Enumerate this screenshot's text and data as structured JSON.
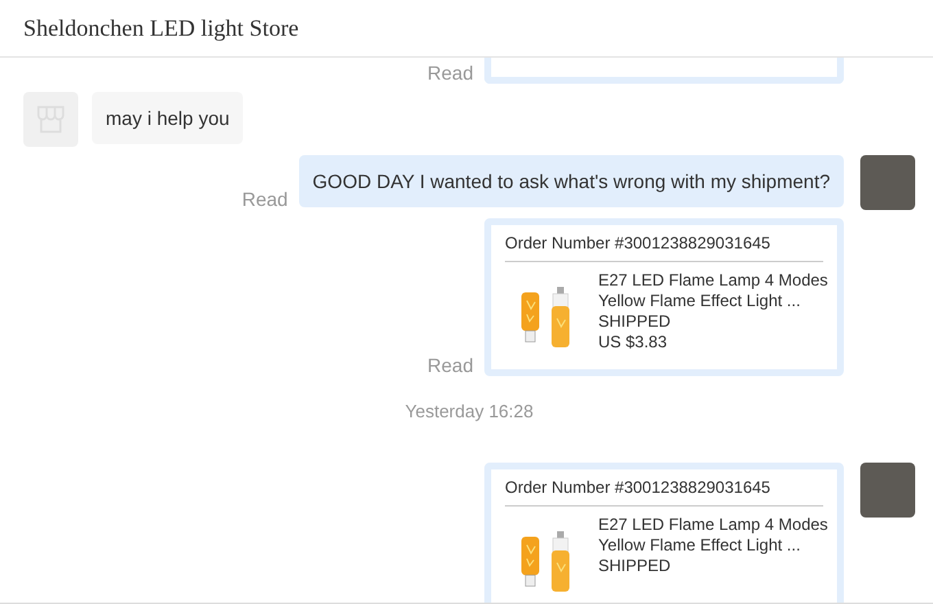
{
  "window": {
    "title": "Sheldonchen LED light Store"
  },
  "messages": [
    {
      "kind": "sent_order_partial",
      "status": "Read",
      "avatar": false
    },
    {
      "kind": "received_text",
      "text": "may i help you",
      "avatar": true
    },
    {
      "kind": "sent_text",
      "text": "GOOD DAY I wanted to ask what's wrong with my shipment?",
      "status": "Read",
      "avatar": true
    },
    {
      "kind": "sent_order",
      "status": "Read",
      "avatar": false,
      "order_number": "Order Number #3001238829031645",
      "product": "E27 LED Flame Lamp 4 Modes Yellow Flame Effect Light ...",
      "state": "SHIPPED",
      "price": "US $3.83"
    },
    {
      "kind": "time",
      "text": "Yesterday 16:28"
    },
    {
      "kind": "sent_order",
      "avatar": true,
      "order_number": "Order Number #3001238829031645",
      "product": "E27 LED Flame Lamp 4 Modes Yellow Flame Effect Light ...",
      "state": "SHIPPED"
    }
  ]
}
